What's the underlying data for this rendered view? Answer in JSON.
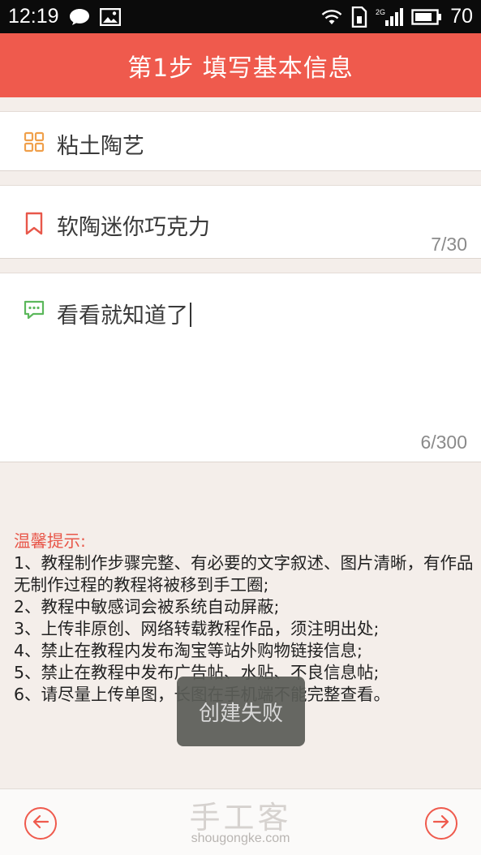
{
  "status_bar": {
    "time": "12:19",
    "network_type": "2G",
    "battery": "70"
  },
  "header": {
    "title": "第1步 填写基本信息"
  },
  "form": {
    "category": {
      "value": "粘土陶艺",
      "icon": "grid-icon"
    },
    "tutorial_title": {
      "value": "软陶迷你巧克力",
      "counter": "7/30",
      "icon": "bookmark-icon"
    },
    "description": {
      "value": "看看就知道了",
      "counter": "6/300",
      "icon": "comment-icon"
    }
  },
  "tips": {
    "title": "温馨提示:",
    "items": [
      "1、教程制作步骤完整、有必要的文字叙述、图片清晰，有作品无制作过程的教程将被移到手工圈;",
      "2、教程中敏感词会被系统自动屏蔽;",
      "3、上传非原创、网络转载教程作品，须注明出处;",
      "4、禁止在教程内发布淘宝等站外购物链接信息;",
      "5、禁止在教程中发布广告帖、水贴、不良信息帖;",
      "6、请尽量上传单图，长图在手机端不能完整查看。"
    ]
  },
  "toast": {
    "message": "创建失败"
  },
  "footer": {
    "brand_cn": "手工客",
    "brand_en": "shougongke.com"
  },
  "colors": {
    "accent": "#ef5a4d",
    "category_icon": "#f0a04b",
    "bookmark_icon": "#e8574a",
    "comment_icon": "#5cb85c",
    "background": "#f4eeea"
  }
}
